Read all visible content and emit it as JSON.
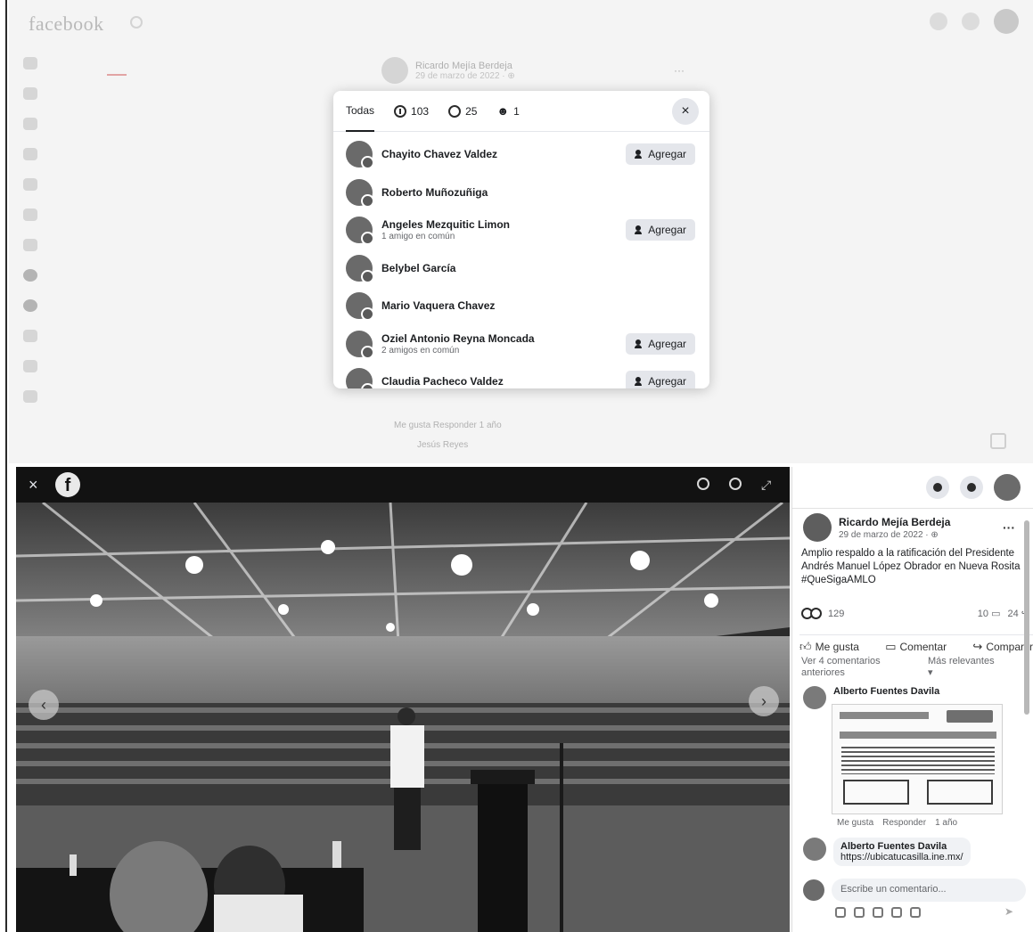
{
  "top_screenshot": {
    "brand": "facebook",
    "background_post": {
      "author": "Ricardo Mejía Berdeja",
      "date": "29 de marzo de 2022 · ⊕",
      "comment_meta": "Me gusta   Responder   1 año",
      "comment_author": "Jesús Reyes"
    }
  },
  "reactions_modal": {
    "tabs": [
      {
        "label": "Todas",
        "active": true
      },
      {
        "label": "103",
        "icon": "like-icon"
      },
      {
        "label": "25",
        "icon": "love-icon"
      },
      {
        "label": "1",
        "icon": "care-icon"
      }
    ],
    "close_label": "×",
    "add_label": "Agregar",
    "people": [
      {
        "name": "Chayito Chavez Valdez",
        "mutual": "",
        "add": true
      },
      {
        "name": "Roberto Muñozuñiga",
        "mutual": "",
        "add": false
      },
      {
        "name": "Angeles Mezquitic Limon",
        "mutual": "1 amigo en común",
        "add": true
      },
      {
        "name": "Belybel García",
        "mutual": "",
        "add": false
      },
      {
        "name": "Mario Vaquera Chavez",
        "mutual": "",
        "add": false
      },
      {
        "name": "Oziel Antonio Reyna Moncada",
        "mutual": "2 amigos en común",
        "add": true
      },
      {
        "name": "Claudia Pacheco Valdez",
        "mutual": "",
        "add": true
      }
    ]
  },
  "photo_viewer": {
    "close_label": "×",
    "logo_letter": "f",
    "prev_label": "‹",
    "next_label": "›"
  },
  "post_panel": {
    "author": "Ricardo Mejía Berdeja",
    "date": "29 de marzo de 2022 · ⊕",
    "more_label": "···",
    "text": "Amplio respaldo a la ratificación del Presidente Andrés Manuel López Obrador en Nueva Rosita #QueSigaAMLO",
    "reaction_count": "129",
    "comments_count": "10",
    "shares_count": "24",
    "actions": {
      "like": "Me gusta",
      "comment": "Comentar",
      "share": "Compartir"
    },
    "previous_comments": "Ver 4 comentarios anteriores",
    "sort_label": "Más relevantes",
    "comments": [
      {
        "author": "Alberto Fuentes Davila",
        "text": "",
        "meta": [
          "Me gusta",
          "Responder",
          "1 año"
        ]
      },
      {
        "author": "Alberto Fuentes Davila",
        "text": "https://ubicatucasilla.ine.mx/"
      }
    ],
    "comment_placeholder": "Escribe un comentario..."
  }
}
